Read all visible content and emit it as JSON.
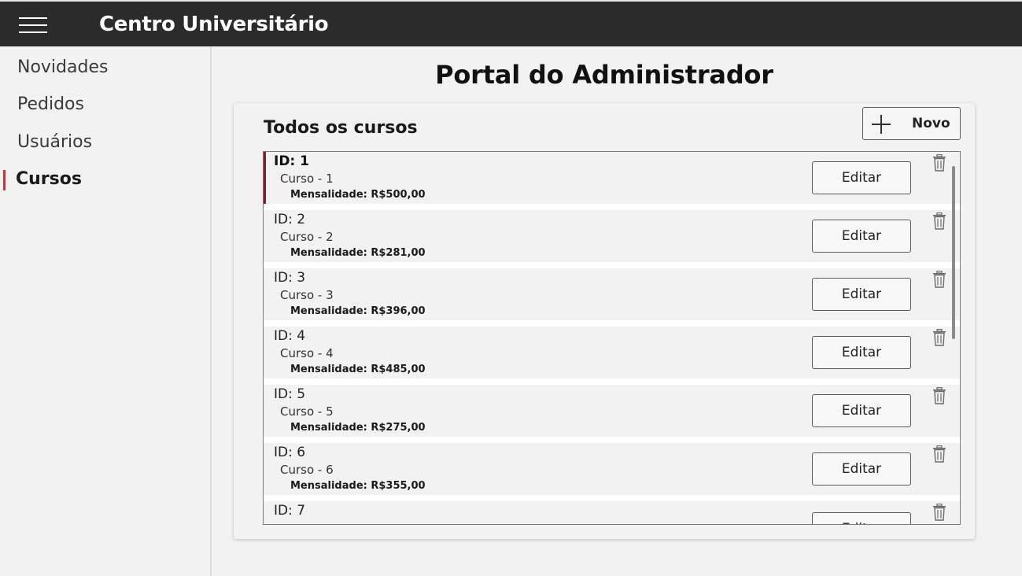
{
  "app": {
    "title": "Centro Universitário"
  },
  "sidebar": {
    "items": [
      {
        "label": "Novidades",
        "active": false
      },
      {
        "label": "Pedidos",
        "active": false
      },
      {
        "label": "Usuários",
        "active": false
      },
      {
        "label": "Cursos",
        "active": true
      }
    ]
  },
  "page": {
    "title": "Portal do Administrador"
  },
  "courses": {
    "title": "Todos os cursos",
    "new_label": "Novo",
    "edit_label": "Editar",
    "items": [
      {
        "id": "ID: 1",
        "name": "Curso - 1",
        "fee": "Mensalidade: R$500,00",
        "selected": true
      },
      {
        "id": "ID: 2",
        "name": "Curso - 2",
        "fee": "Mensalidade: R$281,00",
        "selected": false
      },
      {
        "id": "ID: 3",
        "name": "Curso - 3",
        "fee": "Mensalidade: R$396,00",
        "selected": false
      },
      {
        "id": "ID: 4",
        "name": "Curso - 4",
        "fee": "Mensalidade: R$485,00",
        "selected": false
      },
      {
        "id": "ID: 5",
        "name": "Curso - 5",
        "fee": "Mensalidade: R$275,00",
        "selected": false
      },
      {
        "id": "ID: 6",
        "name": "Curso - 6",
        "fee": "Mensalidade: R$355,00",
        "selected": false
      },
      {
        "id": "ID: 7",
        "name": "",
        "fee": "",
        "selected": false
      }
    ]
  },
  "colors": {
    "titlebar": "#2b2b2b",
    "accent": "#c4343c",
    "selection": "#7d1f2a"
  },
  "icons": {
    "menu": "hamburger-icon",
    "add": "plus-icon",
    "delete": "trash-icon"
  }
}
